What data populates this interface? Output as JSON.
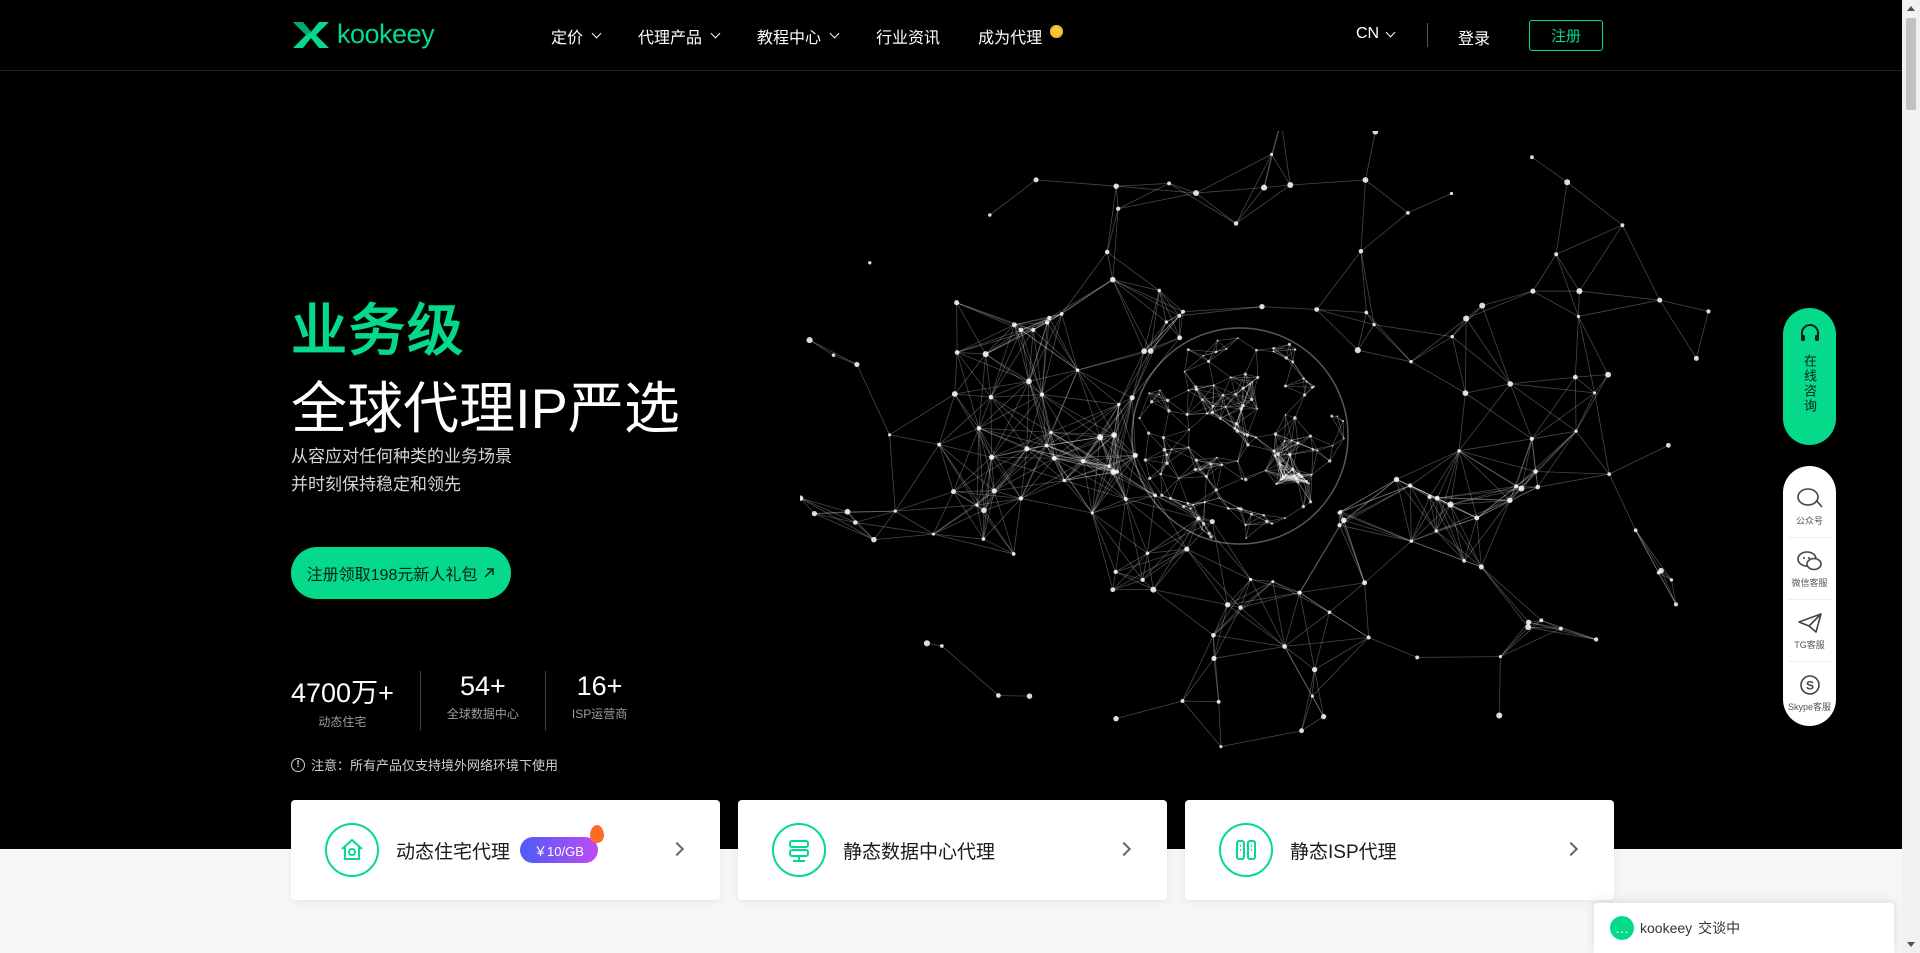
{
  "header": {
    "logo_text": "kookeey",
    "nav": [
      {
        "label": "定价",
        "dropdown": true
      },
      {
        "label": "代理产品",
        "dropdown": true
      },
      {
        "label": "教程中心",
        "dropdown": true
      },
      {
        "label": "行业资讯",
        "dropdown": false
      },
      {
        "label": "成为代理",
        "dropdown": false
      }
    ],
    "lang": "CN",
    "login": "登录",
    "register": "注册"
  },
  "hero": {
    "title_green": "业务级",
    "title_white": "全球代理IP严选",
    "sub_line1": "从容应对任何种类的业务场景",
    "sub_line2": "并时刻保持稳定和领先",
    "cta": "注册领取198元新人礼包",
    "stats": [
      {
        "num": "4700万+",
        "label": "动态住宅"
      },
      {
        "num": "54+",
        "label": "全球数据中心"
      },
      {
        "num": "16+",
        "label": "ISP运营商"
      }
    ],
    "notice": "注意：所有产品仅支持境外网络环境下使用"
  },
  "cards": [
    {
      "title": "动态住宅代理",
      "badge": "￥10/GB"
    },
    {
      "title": "静态数据中心代理"
    },
    {
      "title": "静态ISP代理"
    }
  ],
  "side": {
    "consult": "在线咨询",
    "items": [
      {
        "label": "公众号"
      },
      {
        "label": "微信客服"
      },
      {
        "label": "TG客服"
      },
      {
        "label": "Skype客服"
      }
    ]
  },
  "chat": {
    "brand": "kookeey",
    "status": "交谈中"
  },
  "colors": {
    "accent": "#05d98a",
    "background": "#000000"
  }
}
